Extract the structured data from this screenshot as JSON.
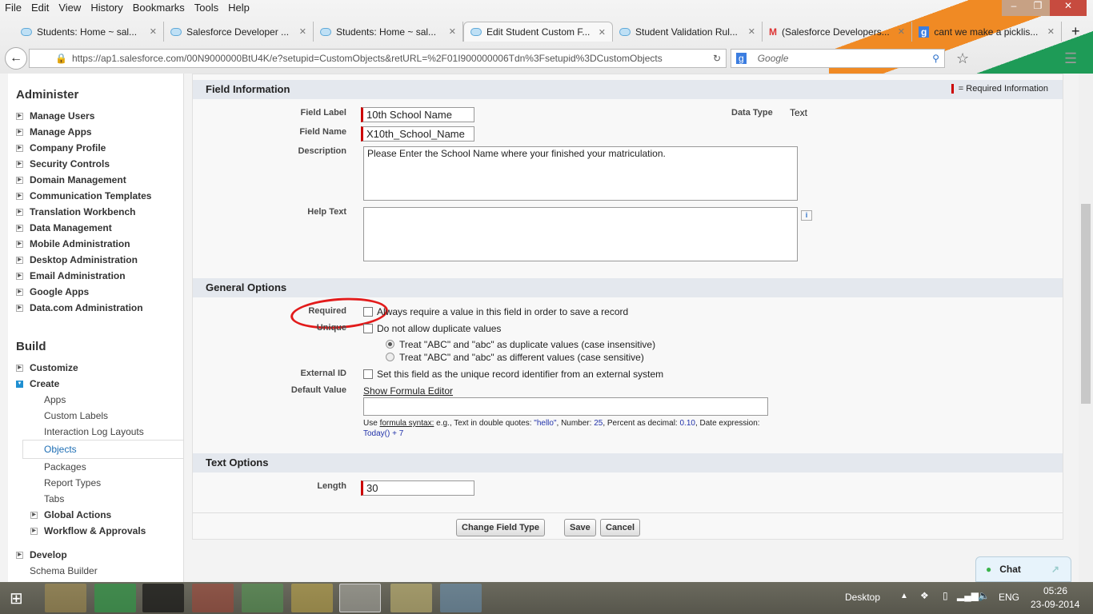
{
  "browser": {
    "menu": [
      "File",
      "Edit",
      "View",
      "History",
      "Bookmarks",
      "Tools",
      "Help"
    ],
    "tabs": [
      "Students: Home ~ sal...",
      "Salesforce Developer ...",
      "Students: Home ~ sal...",
      "Edit Student Custom F...",
      "Student Validation Rul...",
      "(Salesforce Developers...",
      "cant we make a picklis..."
    ],
    "url": "https://ap1.salesforce.com/00N9000000BtU4K/e?setupid=CustomObjects&retURL=%2F01I900000006Tdn%3Fsetupid%3DCustomObjects",
    "search_placeholder": "Google"
  },
  "sidebar": {
    "administer_title": "Administer",
    "administer": [
      "Manage Users",
      "Manage Apps",
      "Company Profile",
      "Security Controls",
      "Domain Management",
      "Communication Templates",
      "Translation Workbench",
      "Data Management",
      "Mobile Administration",
      "Desktop Administration",
      "Email Administration",
      "Google Apps",
      "Data.com Administration"
    ],
    "build_title": "Build",
    "customize": "Customize",
    "create": "Create",
    "create_items": [
      "Apps",
      "Custom Labels",
      "Interaction Log Layouts",
      "Objects",
      "Packages",
      "Report Types",
      "Tabs"
    ],
    "global_actions": "Global Actions",
    "workflow": "Workflow & Approvals",
    "develop": "Develop",
    "schema": "Schema Builder"
  },
  "form": {
    "field_info_title": "Field Information",
    "required_info": "= Required Information",
    "field_label_label": "Field Label",
    "field_label": "10th School Name",
    "field_name_label": "Field Name",
    "field_name": "X10th_School_Name",
    "data_type_label": "Data Type",
    "data_type": "Text",
    "description_label": "Description",
    "description": "Please Enter the School Name where your finished your matriculation.",
    "help_text_label": "Help Text",
    "help_icon": "i",
    "general_title": "General Options",
    "required_label": "Required",
    "required_text": "Always require a value in this field in order to save a record",
    "unique_label": "Unique",
    "unique_text": "Do not allow duplicate values",
    "case_insensitive": "Treat \"ABC\" and \"abc\" as duplicate values (case insensitive)",
    "case_sensitive": "Treat \"ABC\" and \"abc\" as different values (case sensitive)",
    "external_label": "External ID",
    "external_text": "Set this field as the unique record identifier from an external system",
    "default_label": "Default Value",
    "formula_editor": "Show Formula Editor",
    "hint_use": "Use ",
    "hint_link": "formula syntax:",
    "hint_1": " e.g., Text in double quotes: ",
    "hint_hello": "\"hello\"",
    "hint_2": ", Number: ",
    "hint_25": "25",
    "hint_3": ", Percent as decimal: ",
    "hint_010": "0.10",
    "hint_4": ", Date expression: ",
    "hint_today": "Today() + 7",
    "text_options_title": "Text Options",
    "length_label": "Length",
    "length": "30",
    "buttons": [
      "Change Field Type",
      "Save",
      "Cancel"
    ]
  },
  "chat": "Chat",
  "taskbar": {
    "desktop": "Desktop",
    "lang": "ENG",
    "time": "05:26",
    "date": "23-09-2014"
  }
}
